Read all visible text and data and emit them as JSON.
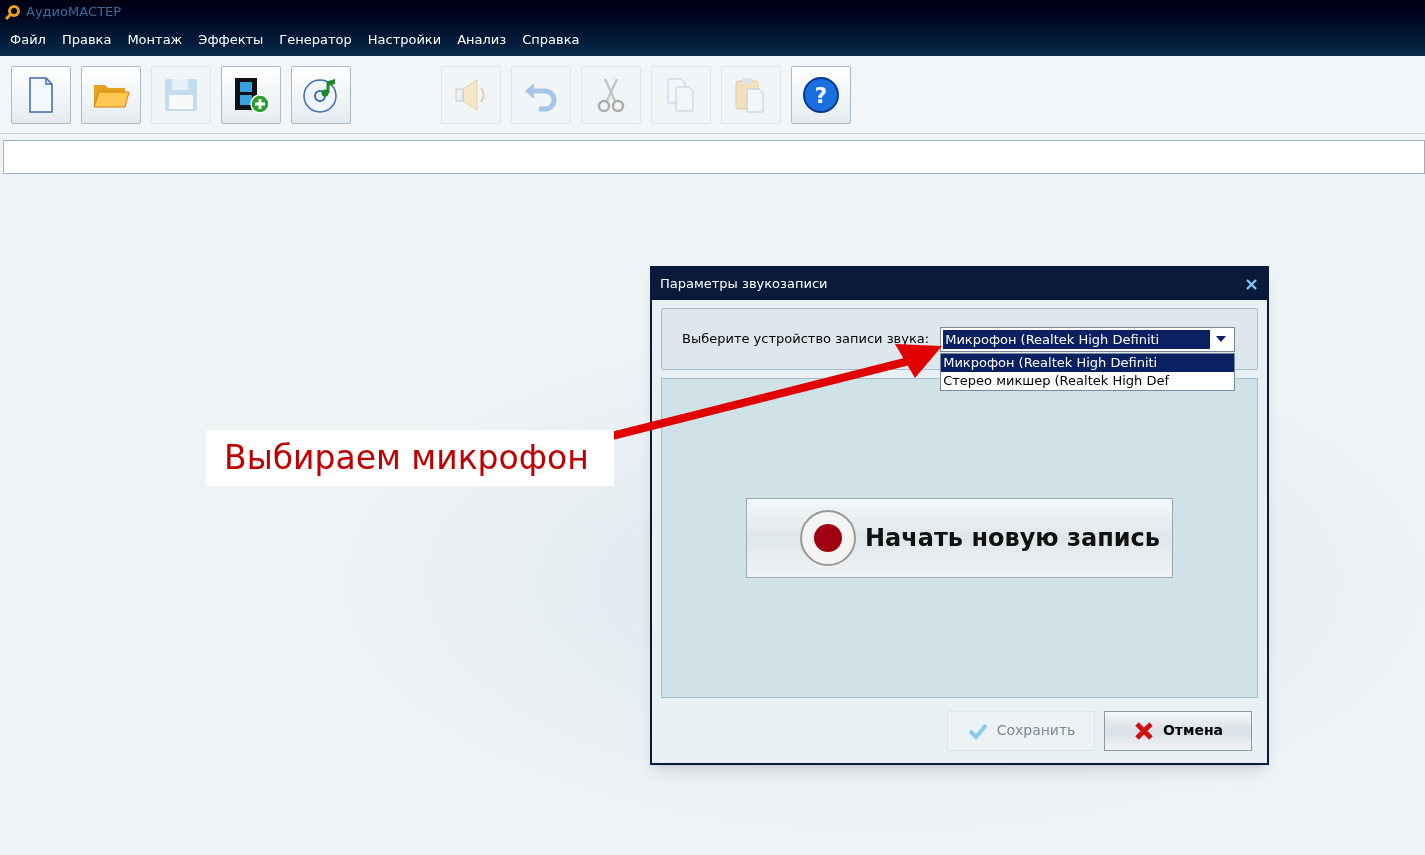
{
  "window": {
    "title": "АудиоМАСТЕР"
  },
  "menu": [
    "Файл",
    "Правка",
    "Монтаж",
    "Эффекты",
    "Генератор",
    "Настройки",
    "Анализ",
    "Справка"
  ],
  "toolbar": [
    [
      {
        "kind": "new",
        "disabled": false
      },
      {
        "kind": "open",
        "disabled": false
      },
      {
        "kind": "save",
        "disabled": true
      },
      {
        "kind": "video",
        "disabled": false
      },
      {
        "kind": "cd",
        "disabled": false
      }
    ],
    [
      {
        "kind": "speaker",
        "disabled": true
      },
      {
        "kind": "undo",
        "disabled": true
      },
      {
        "kind": "cut",
        "disabled": true
      },
      {
        "kind": "copy",
        "disabled": true
      },
      {
        "kind": "paste",
        "disabled": true
      },
      {
        "kind": "help",
        "disabled": false,
        "glyph": "?"
      }
    ]
  ],
  "dialog": {
    "title": "Параметры звукозаписи",
    "close": "×",
    "device_label": "Выберите устройство записи звука:",
    "device_select": {
      "value": "Микрофон (Realtek High Definiti",
      "expanded": true
    },
    "options": [
      {
        "label": "Микрофон (Realtek High Definiti",
        "selected": true
      },
      {
        "label": "Стерео микшер (Realtek High Def",
        "selected": false
      }
    ],
    "record_button": "Начать новую запись",
    "buttons": [
      {
        "kind": "save",
        "label": "Сохранить",
        "disabled": true
      },
      {
        "kind": "cancel",
        "label": "Отмена",
        "disabled": false
      }
    ]
  },
  "annotation": {
    "text": "Выбираем микрофон"
  }
}
